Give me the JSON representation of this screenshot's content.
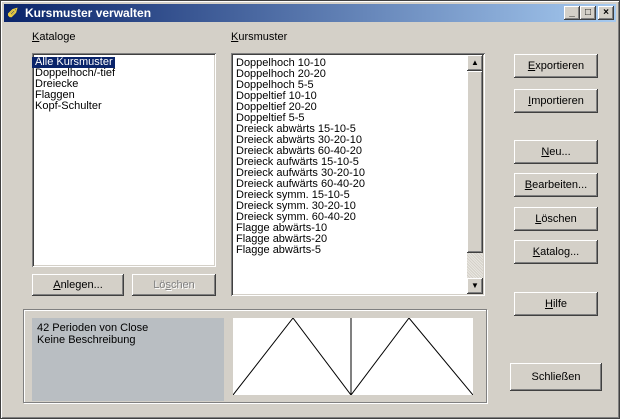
{
  "window": {
    "title": "Kursmuster verwalten",
    "app_icon": "app-icon",
    "controls": {
      "minimize": "_",
      "maximize": "□",
      "close": "×"
    }
  },
  "catalogs": {
    "label_prefix": "K",
    "label_rest": "ataloge",
    "items": [
      "Alle Kursmuster",
      "Doppelhoch/-tief",
      "Dreiecke",
      "Flaggen",
      "Kopf-Schulter"
    ],
    "selected_index": 0,
    "buttons": {
      "add_u": "A",
      "add_rest": "nlegen...",
      "delete_pre": "Lö",
      "delete_u": "s",
      "delete_rest": "chen"
    }
  },
  "patterns": {
    "label_prefix": "K",
    "label_rest": "ursmuster",
    "items": [
      "Doppelhoch 10-10",
      "Doppelhoch 20-20",
      "Doppelhoch 5-5",
      "Doppeltief 10-10",
      "Doppeltief 20-20",
      "Doppeltief 5-5",
      "Dreieck abwärts 15-10-5",
      "Dreieck abwärts 30-20-10",
      "Dreieck abwärts 60-40-20",
      "Dreieck aufwärts 15-10-5",
      "Dreieck aufwärts 30-20-10",
      "Dreieck aufwärts 60-40-20",
      "Dreieck symm. 15-10-5",
      "Dreieck symm. 30-20-10",
      "Dreieck symm. 60-40-20",
      "Flagge abwärts-10",
      "Flagge abwärts-20",
      "Flagge abwärts-5"
    ],
    "scrollbar": {
      "up_icon": "scroll-up-arrow",
      "down_icon": "scroll-down-arrow"
    }
  },
  "actions": {
    "export": {
      "u": "E",
      "rest": "xportieren"
    },
    "import": {
      "u": "I",
      "rest": "mportieren"
    },
    "new": {
      "u": "N",
      "rest": "eu..."
    },
    "edit": {
      "u": "B",
      "rest": "earbeiten..."
    },
    "delete": {
      "u": "L",
      "rest": "öschen"
    },
    "catalog": {
      "u": "K",
      "rest": "atalog..."
    },
    "help": {
      "u": "H",
      "rest": "ilfe"
    },
    "close": {
      "label": "Schließen"
    }
  },
  "description": {
    "line1": "42 Perioden von Close",
    "line2": "Keine Beschreibung"
  },
  "colors": {
    "selection": "#0a246a",
    "face": "#d4d0c8",
    "description_bg": "#b9bec2"
  }
}
